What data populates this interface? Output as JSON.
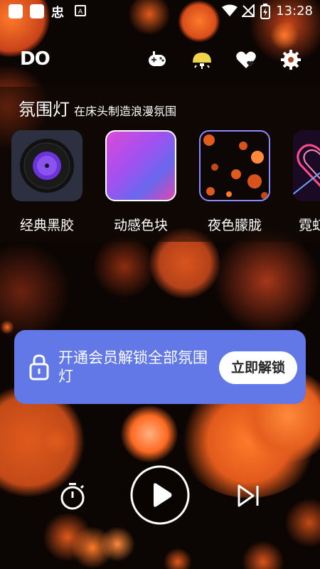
{
  "status_bar": {
    "time": "13:28",
    "left_icons": [
      "notification-icon",
      "notification-icon",
      "app-icon",
      "photo-icon"
    ],
    "right_icons": [
      "wifi-icon",
      "no-sim-icon",
      "battery-charging-icon"
    ],
    "app_glyph": "忠"
  },
  "header": {
    "logo": "DO",
    "icons": [
      "gamepad-icon",
      "lamp-icon",
      "heart-icon",
      "settings-icon"
    ]
  },
  "ambient": {
    "title": "氛围灯",
    "subtitle": "在床头制造浪漫氛围",
    "items": [
      {
        "label": "经典黑胶",
        "icon": "vinyl-record-icon"
      },
      {
        "label": "动感色块",
        "icon": "gradient-icon"
      },
      {
        "label": "夜色朦胧",
        "icon": "bokeh-icon"
      },
      {
        "label": "霓虹",
        "icon": "neon-heart-icon"
      }
    ]
  },
  "unlock_banner": {
    "text": "开通会员解锁全部氛围灯",
    "button": "立即解锁",
    "icon": "lock-icon"
  },
  "player": {
    "controls": [
      "timer-icon",
      "play-icon",
      "skip-next-icon"
    ]
  },
  "colors": {
    "bokeh": "#e8561a",
    "banner": "#6178e6",
    "background": "#0b0503"
  }
}
